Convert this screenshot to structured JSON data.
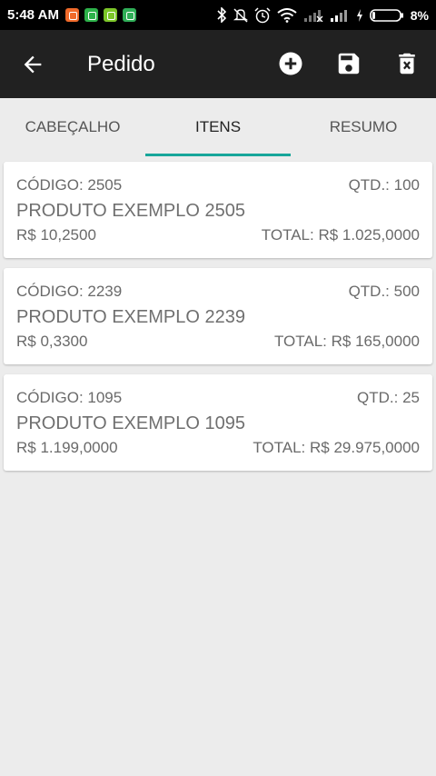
{
  "status_bar": {
    "time": "5:48 AM",
    "notifications": [
      "mail-icon",
      "phone-icon",
      "sim-icon",
      "chat-icon"
    ],
    "icons": [
      "bluetooth-icon",
      "mute-icon",
      "alarm-icon",
      "wifi-icon",
      "signal-icon",
      "signal-icon",
      "charging-icon",
      "battery-icon"
    ],
    "battery": "8%"
  },
  "toolbar": {
    "title": "Pedido",
    "back_icon": "arrow-back-icon",
    "actions": [
      "add-circle-icon",
      "save-icon",
      "delete-icon"
    ]
  },
  "tabs": [
    {
      "label": "CABEÇALHO",
      "active": false
    },
    {
      "label": "ITENS",
      "active": true
    },
    {
      "label": "RESUMO",
      "active": false
    }
  ],
  "items": [
    {
      "code": "CÓDIGO: 2505",
      "qty": "QTD.: 100",
      "name": "PRODUTO EXEMPLO 2505",
      "price": "R$ 10,2500",
      "total": "TOTAL: R$ 1.025,0000"
    },
    {
      "code": "CÓDIGO: 2239",
      "qty": "QTD.: 500",
      "name": "PRODUTO EXEMPLO 2239",
      "price": "R$ 0,3300",
      "total": "TOTAL: R$ 165,0000"
    },
    {
      "code": "CÓDIGO: 1095",
      "qty": "QTD.: 25",
      "name": "PRODUTO EXEMPLO 1095",
      "price": "R$ 1.199,0000",
      "total": "TOTAL: R$ 29.975,0000"
    }
  ],
  "colors": {
    "toolbar": "#212121",
    "tab_indicator": "#17a69a",
    "background": "#ececec"
  }
}
